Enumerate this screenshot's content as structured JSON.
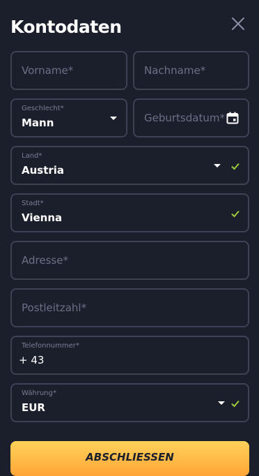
{
  "header": {
    "title": "Kontodaten"
  },
  "fields": {
    "vorname": {
      "placeholder": "Vorname*"
    },
    "nachname": {
      "placeholder": "Nachname*"
    },
    "geschlecht": {
      "label": "Geschlecht*",
      "value": "Mann"
    },
    "geburtsdatum": {
      "placeholder": "Geburtsdatum*"
    },
    "land": {
      "label": "Land*",
      "value": "Austria"
    },
    "stadt": {
      "label": "Stadt*",
      "value": "Vienna"
    },
    "adresse": {
      "placeholder": "Adresse*"
    },
    "postleitzahl": {
      "placeholder": "Postleitzahl*"
    },
    "telefon": {
      "label": "Telefonnummer*",
      "value": "+ 43"
    },
    "waehrung": {
      "label": "Währung*",
      "value": "EUR"
    }
  },
  "submit_label": "ABSCHLIESSEN",
  "colors": {
    "check": "#9ccc3a",
    "accent_top": "#ffd25a",
    "accent_bottom": "#ffa536"
  }
}
